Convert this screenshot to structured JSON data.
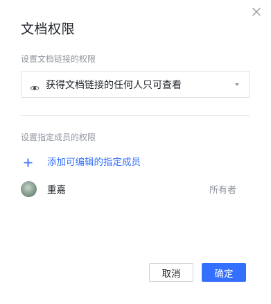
{
  "dialog": {
    "title": "文档权限",
    "link_section": {
      "label": "设置文档链接的权限",
      "select_value": "获得文档链接的任何人只可查看",
      "icon": "eye-icon"
    },
    "member_section": {
      "label": "设置指定成员的权限",
      "add_label": "添加可编辑的指定成员",
      "members": [
        {
          "name": "重嘉",
          "role": "所有者"
        }
      ]
    },
    "buttons": {
      "cancel": "取消",
      "confirm": "确定"
    }
  },
  "colors": {
    "accent": "#3370ff",
    "text_primary": "#1f2329",
    "text_secondary": "#8f959e",
    "border": "#dee0e3"
  }
}
